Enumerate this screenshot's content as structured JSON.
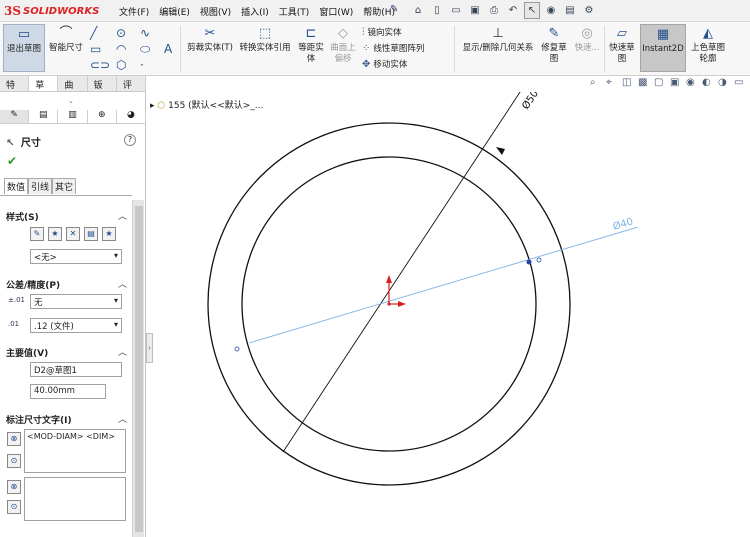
{
  "app": {
    "logo_mark": "3S",
    "logo_text": "SOLIDWORKS"
  },
  "menu": [
    "文件(F)",
    "编辑(E)",
    "视图(V)",
    "插入(I)",
    "工具(T)",
    "窗口(W)",
    "帮助(H)"
  ],
  "toolbar": {
    "exit_sketch": "退出草图",
    "smart_dim": "智能尺寸",
    "trim": "剪裁实体(T)",
    "convert": "转换实体引用",
    "offset": "等距实体",
    "offset_on_surface": "曲面上偏移",
    "mirror": "镜向实体",
    "linear_pattern": "线性草图阵列",
    "move": "移动实体",
    "display_relations": "显示/删除几何关系",
    "repair": "修复草图",
    "quick": "快速...",
    "quick_sketch": "快速草图",
    "instant2d": "Instant2D",
    "shaded_sketch": "上色草图轮廓"
  },
  "tabs": [
    "特征",
    "草图",
    "曲面",
    "钣金",
    "评估"
  ],
  "selected_tab": "草图",
  "tree": {
    "item": "155 (默认<<默认>_..."
  },
  "pm": {
    "title": "尺寸",
    "help": "?",
    "subtabs": [
      "数值",
      "引线",
      "其它"
    ],
    "style_label": "样式(S)",
    "style_value": "<无>",
    "tolerance_label": "公差/精度(P)",
    "tolerance_value": "无",
    "precision_value": ".12 (文件)",
    "primary_label": "主要值(V)",
    "primary_name": "D2@草图1",
    "primary_value": "40.00mm",
    "dimtext_label": "标注尺寸文字(I)",
    "dimtext_value": "<MOD-DIAM> <DIM>"
  },
  "drawing": {
    "outer_dim": "Ø50",
    "inner_dim": "Ø40",
    "colors": {
      "black": "#111111",
      "blue_dim": "#7fb3e6",
      "point": "#2244aa",
      "origin": "#d42020"
    }
  }
}
